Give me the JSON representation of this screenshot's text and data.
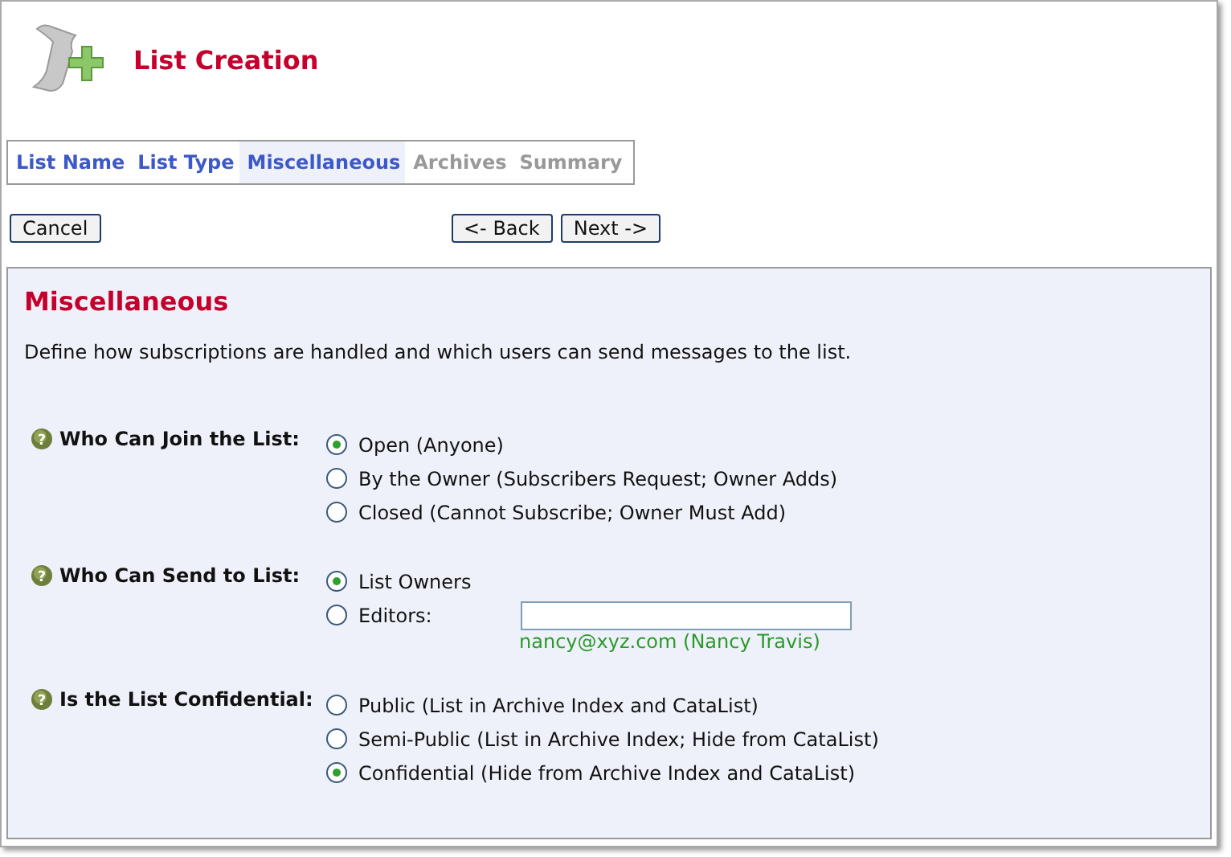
{
  "header": {
    "title": "List Creation"
  },
  "tabs": [
    {
      "label": "List Name",
      "selected": false,
      "disabled": false
    },
    {
      "label": "List Type",
      "selected": false,
      "disabled": false
    },
    {
      "label": "Miscellaneous",
      "selected": true,
      "disabled": false
    },
    {
      "label": "Archives",
      "selected": false,
      "disabled": true
    },
    {
      "label": "Summary",
      "selected": false,
      "disabled": true
    }
  ],
  "buttons": {
    "cancel": "Cancel",
    "back": "<- Back",
    "next": "Next ->"
  },
  "panel": {
    "title": "Miscellaneous",
    "description": "Define how subscriptions are handled and which users can send messages to the list.",
    "groups": [
      {
        "help": "?",
        "label": "Who Can Join the List:",
        "options": [
          {
            "kind": "radio",
            "label": "Open (Anyone)",
            "selected": true
          },
          {
            "kind": "radio",
            "label": "By the Owner (Subscribers Request; Owner Adds)",
            "selected": false
          },
          {
            "kind": "radio",
            "label": "Closed (Cannot Subscribe; Owner Must Add)",
            "selected": false
          }
        ]
      },
      {
        "help": "?",
        "label": "Who Can Send to List:",
        "options": [
          {
            "kind": "radio",
            "label": "List Owners",
            "selected": true
          },
          {
            "kind": "field",
            "label": "Editors:",
            "selected": false,
            "hint": "nancy@xyz.com (Nancy Travis)"
          }
        ]
      },
      {
        "help": "?",
        "label": "Is the List Confidential:",
        "options": [
          {
            "kind": "radio",
            "label": "Public (List in Archive Index and CataList)",
            "selected": false
          },
          {
            "kind": "radio",
            "label": "Semi-Public (List in Archive Index; Hide from CataList)",
            "selected": false
          },
          {
            "kind": "radio",
            "label": "Confidential (Hide from Archive Index and CataList)",
            "selected": true
          }
        ]
      }
    ]
  }
}
